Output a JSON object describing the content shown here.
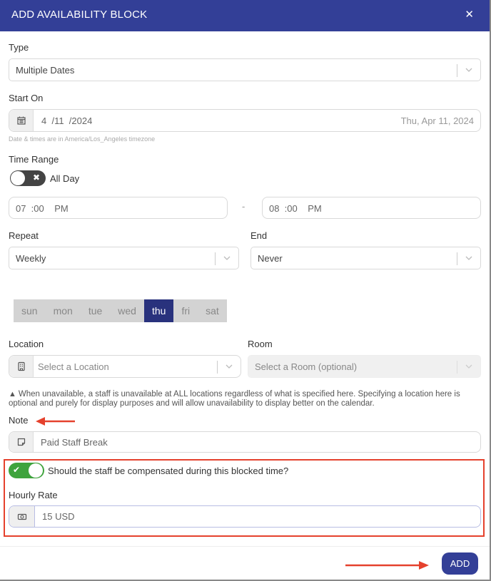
{
  "header": {
    "title": "ADD AVAILABILITY BLOCK",
    "close_icon": "close-icon",
    "close_glyph": "✕"
  },
  "type": {
    "label": "Type",
    "value": "Multiple Dates"
  },
  "start_on": {
    "label": "Start On",
    "month": "4",
    "day": "11",
    "year": "2024",
    "date_display": "4  /11  /2024",
    "formatted": "Thu, Apr 11, 2024",
    "timezone_note": "Date & times are in America/Los_Angeles timezone",
    "icon": "calendar-icon"
  },
  "time_range": {
    "label": "Time Range",
    "all_day_label": "All Day",
    "all_day_on": false,
    "start": "07  :00    PM",
    "end": "08  :00    PM",
    "separator": "-"
  },
  "repeat": {
    "label": "Repeat",
    "value": "Weekly"
  },
  "end": {
    "label": "End",
    "value": "Never"
  },
  "days": [
    {
      "label": "sun",
      "selected": false
    },
    {
      "label": "mon",
      "selected": false
    },
    {
      "label": "tue",
      "selected": false
    },
    {
      "label": "wed",
      "selected": false
    },
    {
      "label": "thu",
      "selected": true
    },
    {
      "label": "fri",
      "selected": false
    },
    {
      "label": "sat",
      "selected": false
    }
  ],
  "location": {
    "label": "Location",
    "placeholder": "Select a Location",
    "icon": "building-icon"
  },
  "room": {
    "label": "Room",
    "placeholder": "Select a Room (optional)",
    "disabled": true
  },
  "warning": {
    "icon": "warning-icon",
    "text": "When unavailable, a staff is unavailable at ALL locations regardless of what is specified here. Specifying a location here is optional and purely for display purposes and will allow unavailability to display better on the calendar."
  },
  "note": {
    "label": "Note",
    "value": "Paid Staff Break",
    "icon": "note-icon"
  },
  "compensated": {
    "label": "Should the staff be compensated during this blocked time?",
    "on": true
  },
  "hourly_rate": {
    "label": "Hourly Rate",
    "value": "15 USD",
    "icon": "money-icon"
  },
  "footer": {
    "add_label": "ADD"
  },
  "colors": {
    "brand": "#333f97",
    "day_active": "#29327d",
    "toggle_on": "#3fa33d",
    "toggle_off": "#444444",
    "annotation": "#e5412d"
  }
}
